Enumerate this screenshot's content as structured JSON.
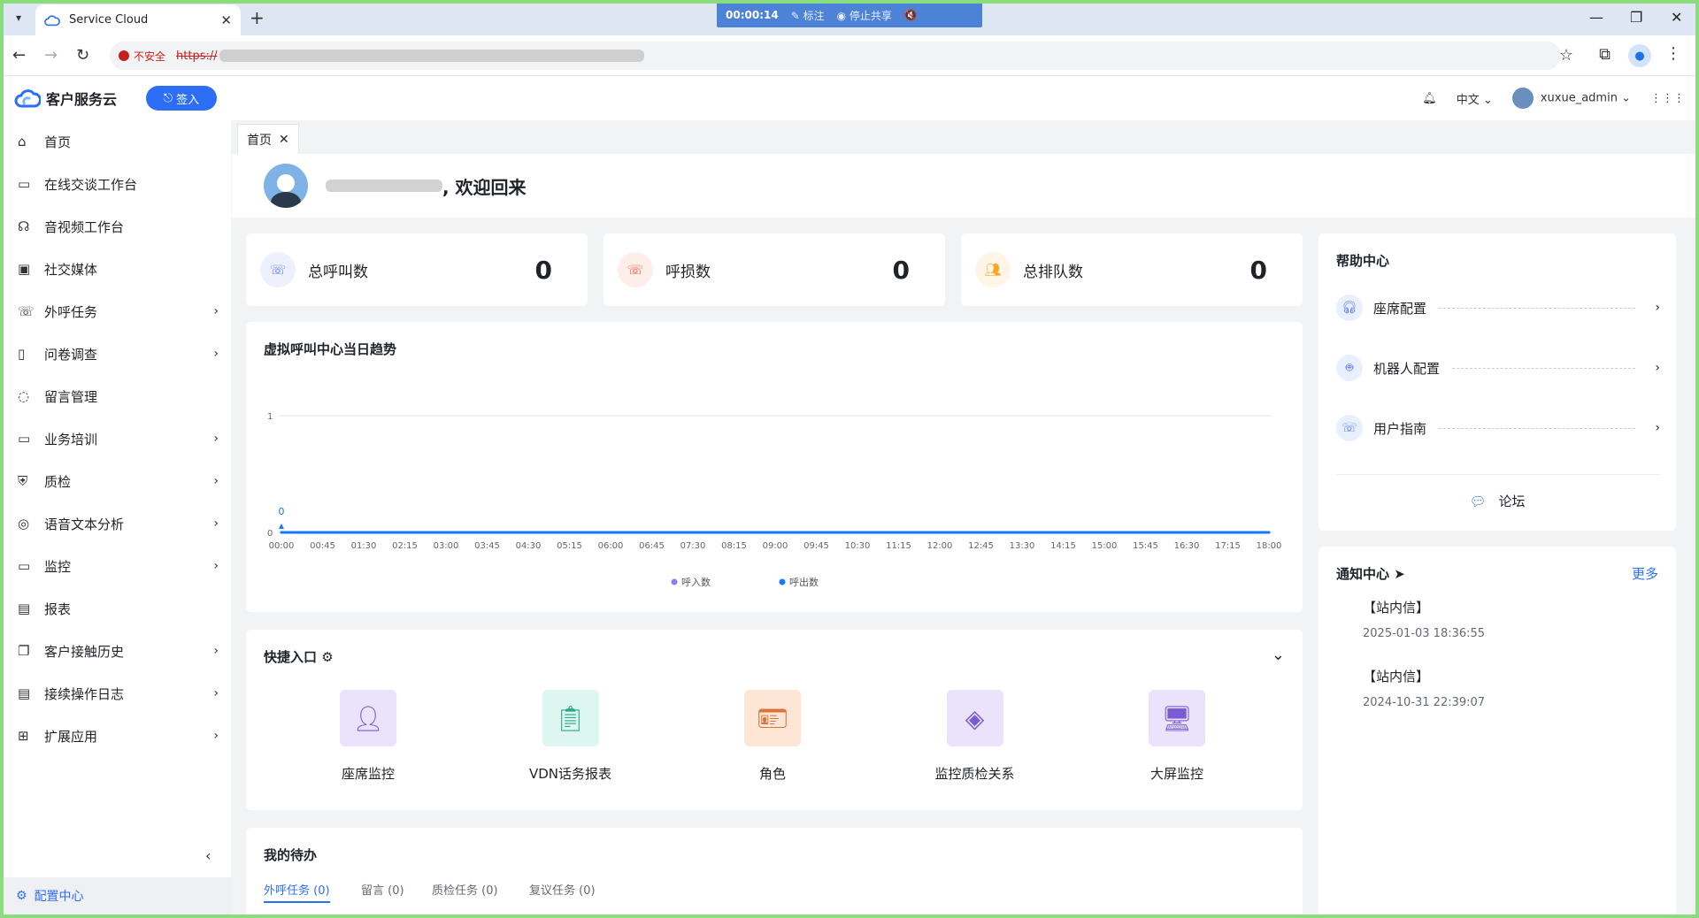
{
  "browser": {
    "tab_title": "Service Cloud",
    "new_tab": "+",
    "share": {
      "timer": "00:00:14",
      "annotate": "标注",
      "stop": "停止共享"
    },
    "security_label": "不安全",
    "url_prefix": "https://"
  },
  "header": {
    "app_name": "客户服务云",
    "signin_label": "签入",
    "language": "中文",
    "username": "xuxue_admin"
  },
  "sidebar": {
    "items": [
      {
        "label": "首页",
        "icon": "home-icon",
        "has_children": false
      },
      {
        "label": "在线交谈工作台",
        "icon": "chat-icon",
        "has_children": false
      },
      {
        "label": "音视频工作台",
        "icon": "headset-icon",
        "has_children": false
      },
      {
        "label": "社交媒体",
        "icon": "social-icon",
        "has_children": false
      },
      {
        "label": "外呼任务",
        "icon": "phone-icon",
        "has_children": true
      },
      {
        "label": "问卷调查",
        "icon": "survey-icon",
        "has_children": true
      },
      {
        "label": "留言管理",
        "icon": "message-icon",
        "has_children": false
      },
      {
        "label": "业务培训",
        "icon": "training-icon",
        "has_children": true
      },
      {
        "label": "质检",
        "icon": "shield-icon",
        "has_children": true
      },
      {
        "label": "语音文本分析",
        "icon": "analysis-icon",
        "has_children": true
      },
      {
        "label": "监控",
        "icon": "monitor-icon",
        "has_children": true
      },
      {
        "label": "报表",
        "icon": "report-icon",
        "has_children": false
      },
      {
        "label": "客户接触历史",
        "icon": "history-icon",
        "has_children": true
      },
      {
        "label": "接续操作日志",
        "icon": "log-icon",
        "has_children": true
      },
      {
        "label": "扩展应用",
        "icon": "apps-icon",
        "has_children": true
      }
    ],
    "config_label": "配置中心"
  },
  "page_tab": "首页",
  "welcome": {
    "suffix": ", 欢迎回来"
  },
  "stats": [
    {
      "label": "总呼叫数",
      "value": "0",
      "color": "#5b7be8",
      "bg": "#eef1fd"
    },
    {
      "label": "呼损数",
      "value": "0",
      "color": "#f0562e",
      "bg": "#fdeeea"
    },
    {
      "label": "总排队数",
      "value": "0",
      "color": "#f5a623",
      "bg": "#fef5e6"
    }
  ],
  "trend": {
    "title": "虚拟呼叫中心当日趋势",
    "chart_data": {
      "type": "line",
      "x": [
        "00:00",
        "00:45",
        "01:30",
        "02:15",
        "03:00",
        "03:45",
        "04:30",
        "05:15",
        "06:00",
        "06:45",
        "07:30",
        "08:15",
        "09:00",
        "09:45",
        "10:30",
        "11:15",
        "12:00",
        "12:45",
        "13:30",
        "14:15",
        "15:00",
        "15:45",
        "16:30",
        "17:15",
        "18:00"
      ],
      "yticks": [
        "0",
        "1"
      ],
      "ylim": [
        0,
        1
      ],
      "series": [
        {
          "name": "呼入数",
          "color": "#8e7cf0",
          "values": [
            0,
            0,
            0,
            0,
            0,
            0,
            0,
            0,
            0,
            0,
            0,
            0,
            0,
            0,
            0,
            0,
            0,
            0,
            0,
            0,
            0,
            0,
            0,
            0,
            0
          ]
        },
        {
          "name": "呼出数",
          "color": "#1677ff",
          "values": [
            0,
            0,
            0,
            0,
            0,
            0,
            0,
            0,
            0,
            0,
            0,
            0,
            0,
            0,
            0,
            0,
            0,
            0,
            0,
            0,
            0,
            0,
            0,
            0,
            0
          ]
        }
      ],
      "annotation": "0",
      "legend": "bottom-center"
    }
  },
  "shortcuts": {
    "title": "快捷入口",
    "items": [
      {
        "label": "座席监控",
        "bg": "#ebe3fb",
        "color": "#7b5ad6"
      },
      {
        "label": "VDN话务报表",
        "bg": "#ddf6ef",
        "color": "#28a98a"
      },
      {
        "label": "角色",
        "bg": "#fde6d6",
        "color": "#d7743a"
      },
      {
        "label": "监控质检关系",
        "bg": "#ebe3fb",
        "color": "#7b5ad6"
      },
      {
        "label": "大屏监控",
        "bg": "#ebe3fb",
        "color": "#7b5ad6"
      }
    ]
  },
  "todo": {
    "title": "我的待办",
    "tabs": [
      "外呼任务 (0)",
      "留言 (0)",
      "质检任务 (0)",
      "复议任务 (0)"
    ]
  },
  "help": {
    "title": "帮助中心",
    "items": [
      "座席配置",
      "机器人配置",
      "用户指南"
    ],
    "forum": "论坛"
  },
  "notices": {
    "title": "通知中心",
    "more": "更多",
    "items": [
      {
        "title": "【站内信】",
        "time": "2025-01-03 18:36:55"
      },
      {
        "title": "【站内信】",
        "time": "2024-10-31 22:39:07"
      }
    ]
  }
}
